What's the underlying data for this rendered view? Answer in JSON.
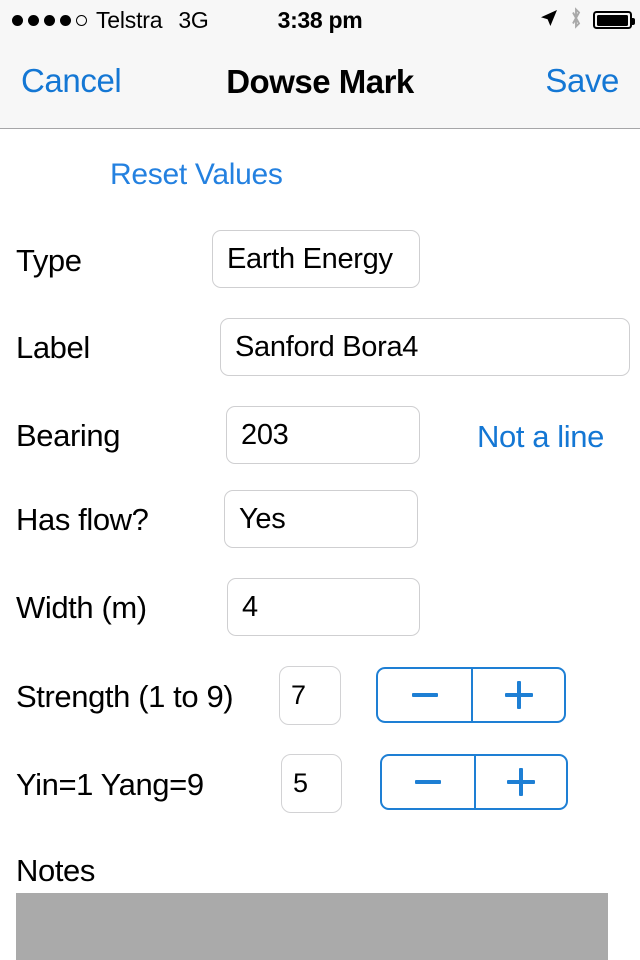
{
  "status_bar": {
    "signal_dots_filled": 4,
    "signal_dots_total": 5,
    "carrier": "Telstra",
    "network": "3G",
    "time": "3:38 pm",
    "icons": [
      "location-arrow-icon",
      "bluetooth-icon",
      "battery-icon"
    ],
    "battery_level": 100
  },
  "nav_bar": {
    "cancel_label": "Cancel",
    "title": "Dowse Mark",
    "save_label": "Save",
    "tint_color": "#1477d4",
    "background_color": "#f7f7f7"
  },
  "form": {
    "reset_label": "Reset Values",
    "rows": [
      {
        "label": "Type",
        "value": "Earth Energy"
      },
      {
        "label": "Label",
        "value": "Sanford Bora4"
      },
      {
        "label": "Bearing",
        "value": "203",
        "side_link": "Not a line"
      },
      {
        "label": "Has flow?",
        "value": "Yes"
      },
      {
        "label": "Width (m)",
        "value": "4"
      },
      {
        "label": "Strength (1 to 9)",
        "value": "7",
        "stepper": true
      },
      {
        "label": "Yin=1 Yang=9",
        "value": "5",
        "stepper": true
      }
    ],
    "stepper": {
      "decrement_label": "−",
      "increment_label": "+"
    },
    "notes_label": "Notes",
    "notes_value": "",
    "accent_color": "#1e7fd4"
  }
}
